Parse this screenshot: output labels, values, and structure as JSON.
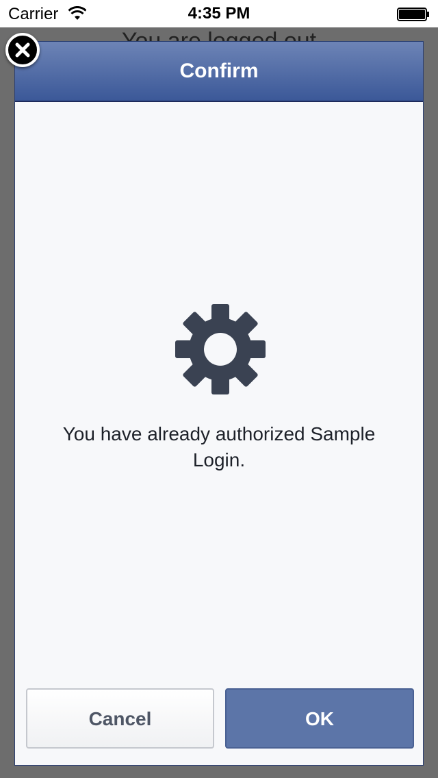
{
  "status_bar": {
    "carrier": "Carrier",
    "time": "4:35 PM"
  },
  "background": {
    "text": "You are logged out"
  },
  "dialog": {
    "title": "Confirm",
    "message": "You have already authorized Sample Login.",
    "cancel_label": "Cancel",
    "ok_label": "OK"
  },
  "icons": {
    "close": "close-icon",
    "gear": "gear-icon",
    "wifi": "wifi-icon",
    "battery": "battery-icon"
  },
  "colors": {
    "header_top": "#6d84b6",
    "header_bottom": "#3b5898",
    "ok_button": "#5c75a8",
    "gear": "#3a4252"
  }
}
